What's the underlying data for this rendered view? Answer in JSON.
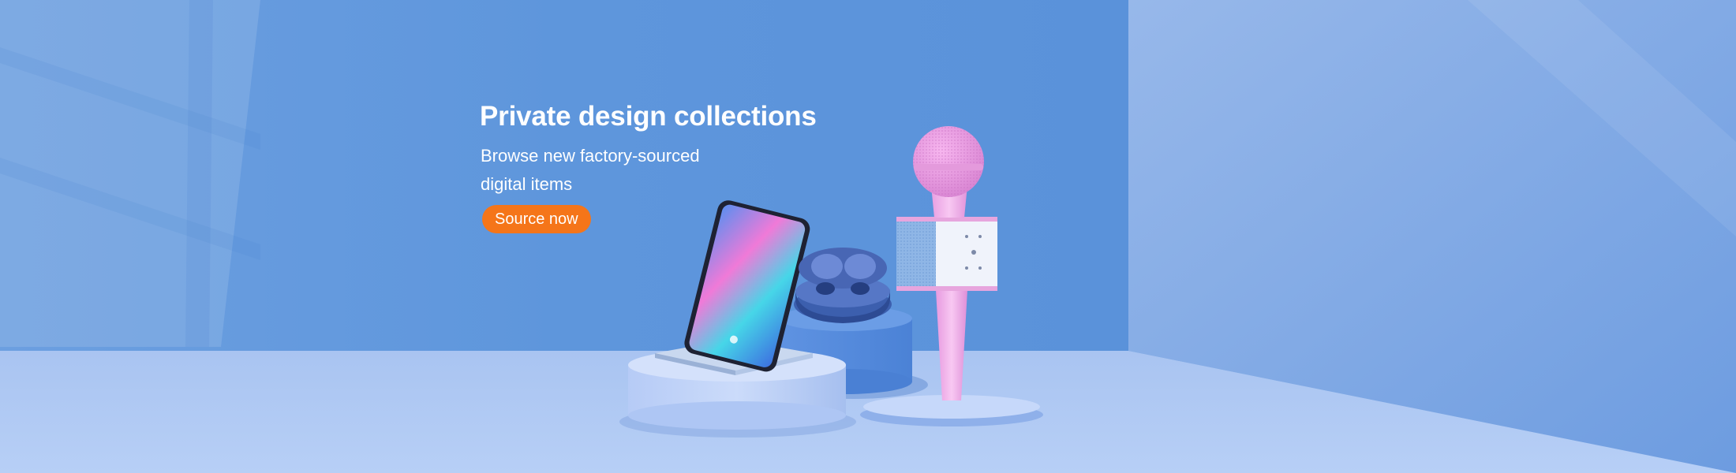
{
  "hero": {
    "title": "Private design collections",
    "subtitle": "Browse new factory-sourced digital items",
    "cta_label": "Source now"
  },
  "colors": {
    "wall": "#5f98dd",
    "floor": "#b4cbf4",
    "cta": "#f57519",
    "text": "#ffffff"
  },
  "products": [
    "phone-on-wireless-charger",
    "earbuds-in-case",
    "karaoke-microphone"
  ]
}
